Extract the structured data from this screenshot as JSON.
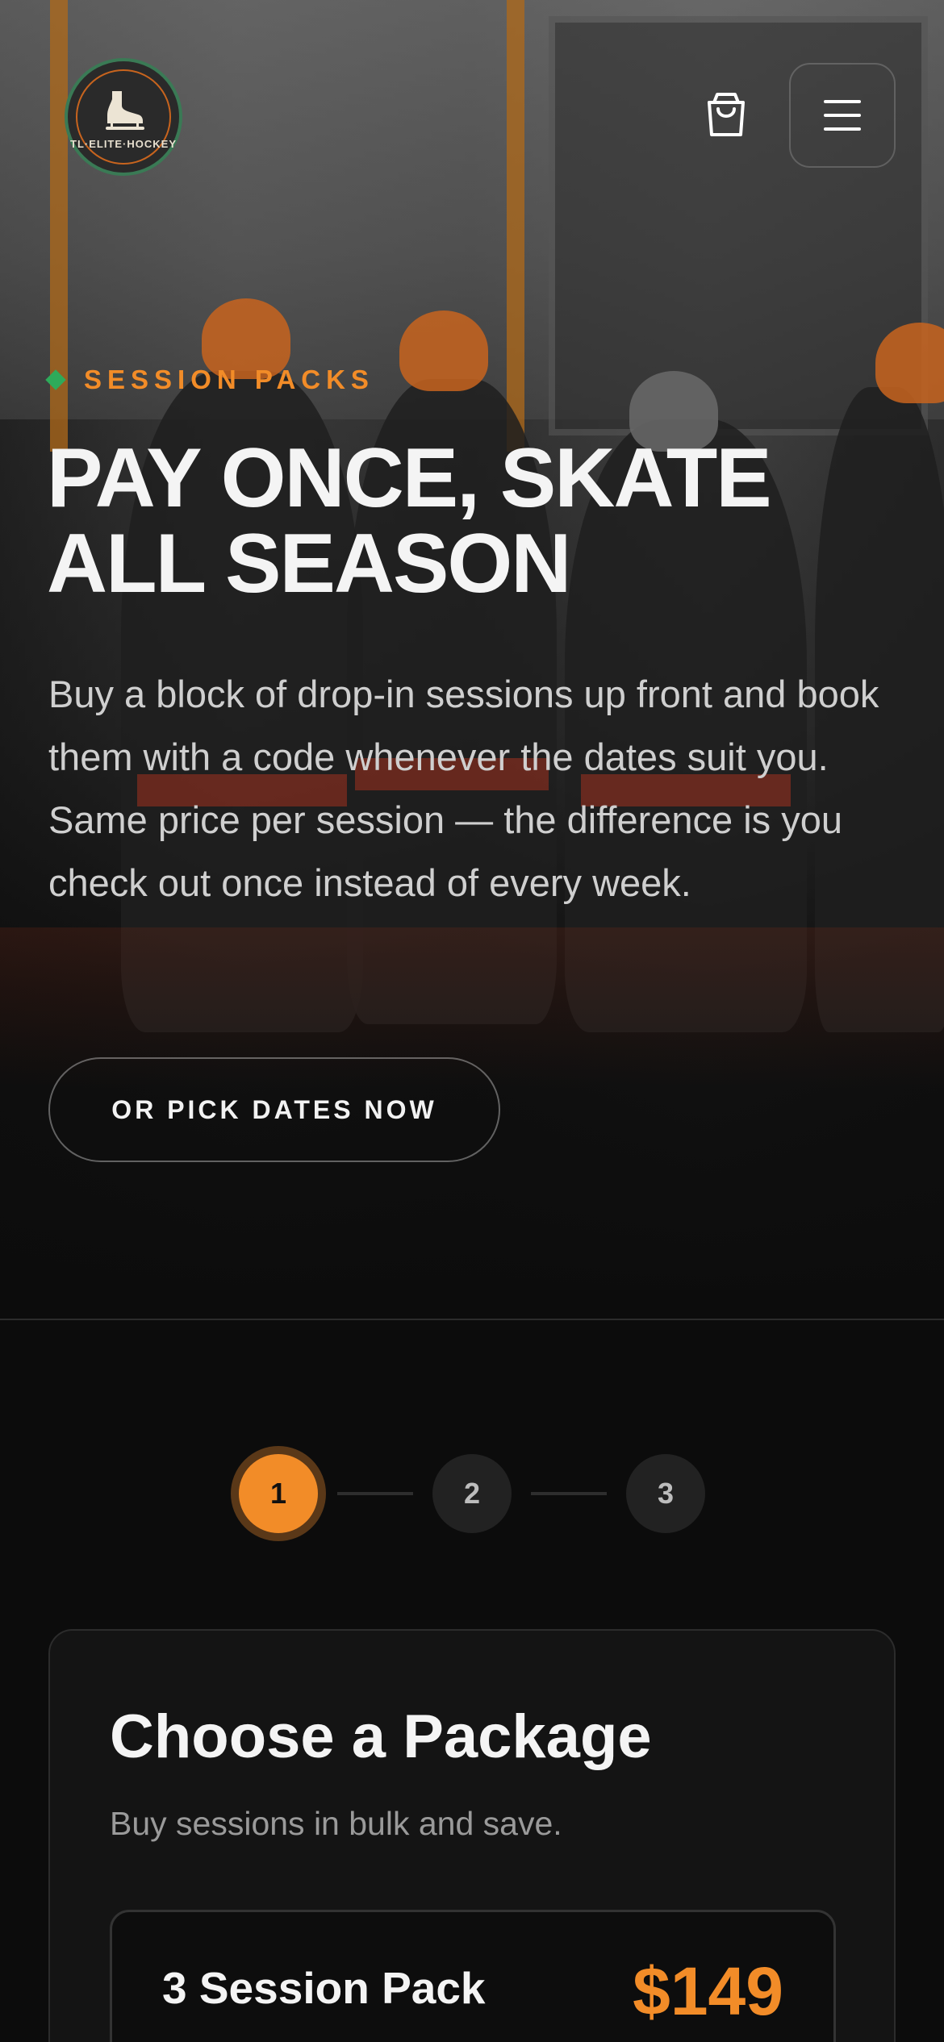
{
  "header": {
    "logo_text": "TL·ELITE·HOCKEY",
    "cart_label": "Cart",
    "menu_label": "Menu"
  },
  "hero": {
    "eyebrow": "SESSION PACKS",
    "headline": "PAY ONCE, SKATE ALL SEASON",
    "lede": "Buy a block of drop-in sessions up front and book them with a code whenever the dates suit you. Same price per session — the difference is you check out once instead of every week.",
    "cta": "OR PICK DATES NOW"
  },
  "stepper": {
    "steps": [
      "1",
      "2",
      "3"
    ],
    "active": 1
  },
  "package": {
    "title": "Choose a Package",
    "subtitle": "Buy sessions in bulk and save.",
    "items": [
      {
        "name": "3 Session Pack",
        "price": "$149"
      }
    ]
  },
  "colors": {
    "accent": "#f28c28",
    "eyebrow_diamond": "#2eaa5a",
    "background": "#0c0c0c"
  },
  "icons": {
    "cart": "shopping-bag-icon",
    "menu": "hamburger-icon",
    "logo": "skate-icon"
  }
}
